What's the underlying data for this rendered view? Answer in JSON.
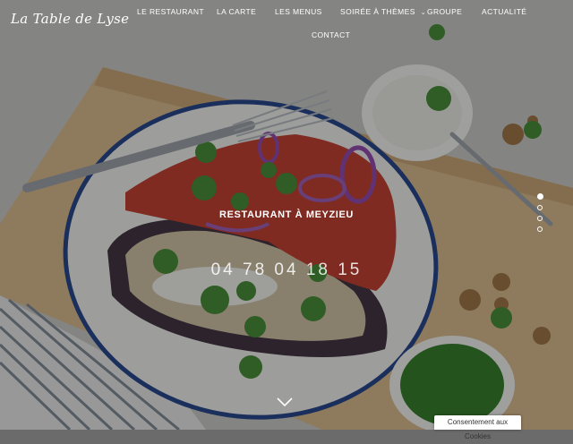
{
  "brand": {
    "logo_text": "La Table de Lyse"
  },
  "nav": {
    "items": [
      {
        "label": "LE RESTAURANT"
      },
      {
        "label": "LA CARTE"
      },
      {
        "label": "LES MENUS"
      },
      {
        "label": "SOIRÉE À THÈMES",
        "has_dropdown": true
      },
      {
        "label": "GROUPE"
      },
      {
        "label": "ACTUALITÉ"
      },
      {
        "label": "CONTACT"
      }
    ]
  },
  "hero": {
    "title": "RESTAURANT À MEYZIEU",
    "phone": "04 78 04 18 15",
    "slide_count": 4,
    "active_slide": 1
  },
  "cookies": {
    "label": "Consentement aux Cookies"
  },
  "icons": {
    "dropdown": "chevron-down-icon",
    "scroll_down": "chevron-down-icon"
  },
  "colors": {
    "overlay": "#141414",
    "text": "#ffffff"
  }
}
